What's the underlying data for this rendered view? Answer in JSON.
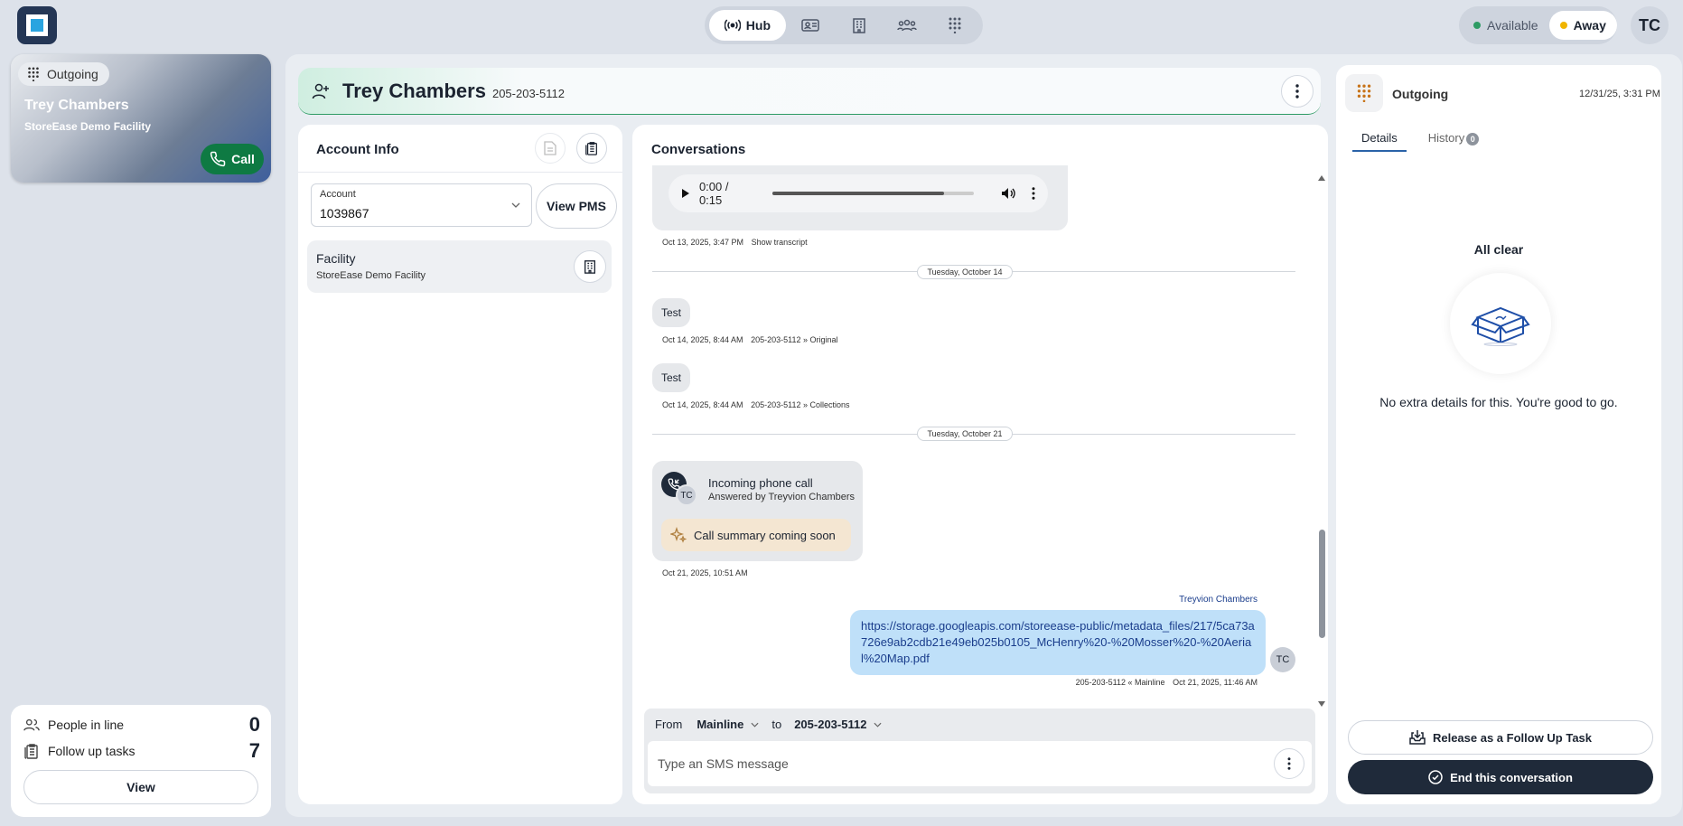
{
  "top_nav": {
    "hub_label": "Hub"
  },
  "status": {
    "available_label": "Available",
    "away_label": "Away",
    "available_color": "#2e9b64",
    "away_color": "#f0b400"
  },
  "user": {
    "initials": "TC"
  },
  "active_call": {
    "direction": "Outgoing",
    "name": "Trey Chambers",
    "facility": "StoreEase Demo Facility",
    "call_label": "Call"
  },
  "queue": {
    "people_label": "People in line",
    "people_count": "0",
    "tasks_label": "Follow up tasks",
    "tasks_count": "7",
    "view_label": "View"
  },
  "contact_header": {
    "name": "Trey Chambers",
    "phone": "205-203-5112"
  },
  "account_info": {
    "title": "Account Info",
    "account_label": "Account",
    "account_value": "1039867",
    "view_pms_label": "View PMS",
    "facility_title": "Facility",
    "facility_name": "StoreEase Demo Facility"
  },
  "conversations": {
    "title": "Conversations",
    "audio": {
      "time": "0:00 / 0:15",
      "progress": 0.85,
      "meta_time": "Oct 13, 2025, 3:47 PM",
      "transcript_label": "Show transcript"
    },
    "separators": [
      "Tuesday, October 14",
      "Tuesday, October 21"
    ],
    "messages": [
      {
        "text": "Test",
        "time": "Oct 14, 2025, 8:44 AM",
        "phone": "205-203-5112",
        "line": "Original"
      },
      {
        "text": "Test",
        "time": "Oct 14, 2025, 8:44 AM",
        "phone": "205-203-5112",
        "line": "Collections"
      }
    ],
    "call": {
      "title": "Incoming phone call",
      "subtitle": "Answered by Treyvion Chambers",
      "agent_initials": "TC",
      "summary": "Call summary coming soon",
      "time": "Oct 21, 2025, 10:51 AM"
    },
    "outgoing": {
      "sender": "Treyvion Chambers",
      "text": "https://storage.googleapis.com/storeease-public/metadata_files/217/5ca73a726e9ab2cdb21e49eb025b0105_McHenry%20-%20Mosser%20-%20Aerial%20Map.pdf",
      "phone": "205-203-5112",
      "line": "Mainline",
      "time": "Oct 21, 2025, 11:46 AM",
      "initials": "TC"
    },
    "composer": {
      "from_label": "From",
      "from_value": "Mainline",
      "to_label": "to",
      "to_value": "205-203-5112",
      "placeholder": "Type an SMS message"
    }
  },
  "details_panel": {
    "title": "Outgoing",
    "date": "12/31/25, 3:31 PM",
    "tab_details": "Details",
    "tab_history": "History",
    "history_count": "0",
    "empty_title": "All clear",
    "empty_text": "No extra details for this. You're good to go.",
    "release_label": "Release as a Follow Up Task",
    "end_label": "End this conversation"
  }
}
